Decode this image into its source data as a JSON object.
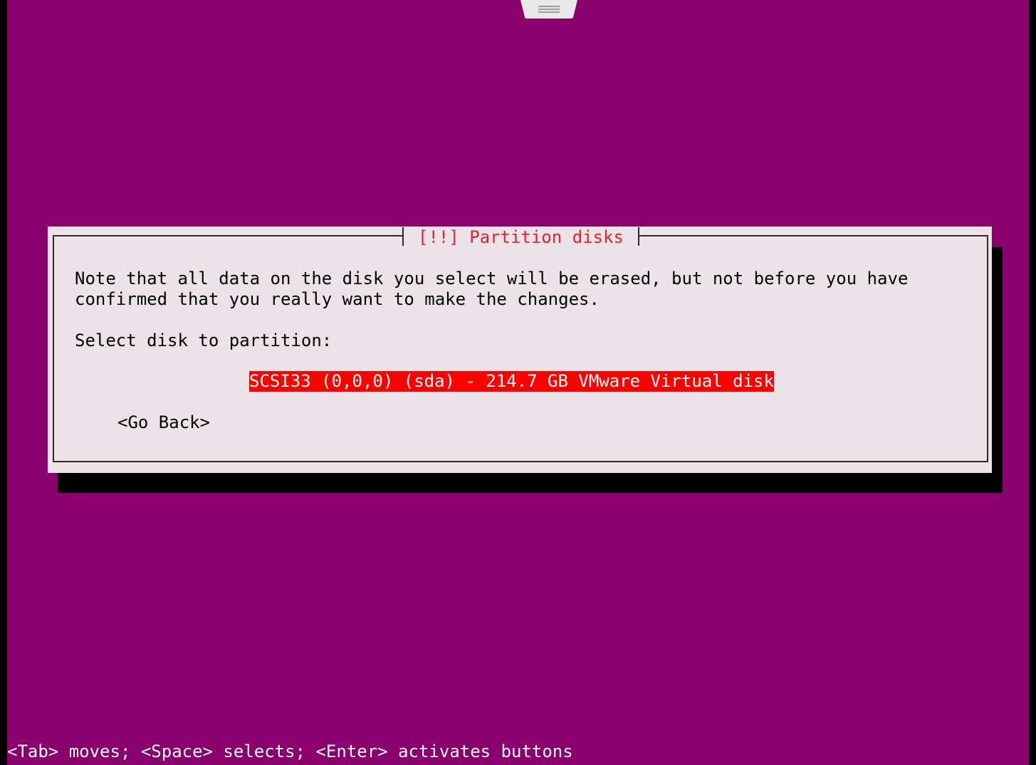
{
  "installer": {
    "dialog": {
      "title": "[!!] Partition disks",
      "description_line1": "Note that all data on the disk you select will be erased, but not before you have",
      "description_line2": "confirmed that you really want to make the changes.",
      "prompt": "Select disk to partition:",
      "disks": [
        {
          "label": "SCSI33 (0,0,0) (sda) - 214.7 GB VMware Virtual disk",
          "selected": true
        }
      ],
      "go_back_label": "<Go Back>"
    },
    "help_line": "<Tab> moves; <Space> selects; <Enter> activates buttons"
  },
  "colors": {
    "background": "#8a006c",
    "dialog": "#ebe3e7",
    "title_text": "#e5202e",
    "selection": "#ff0000"
  },
  "icons": {
    "vm_toolbar_handle": "menu-handle-icon"
  }
}
